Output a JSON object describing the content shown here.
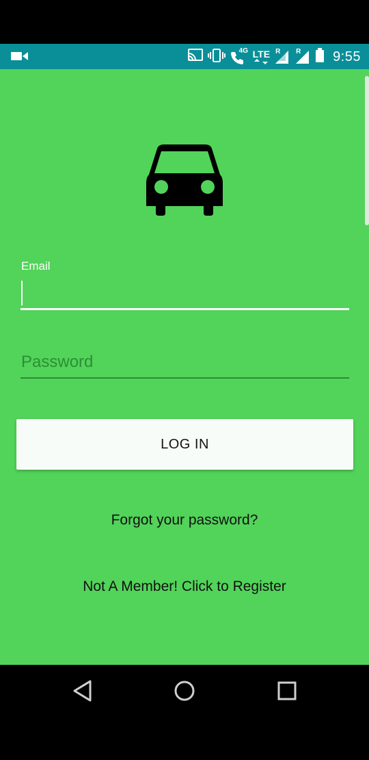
{
  "status_bar": {
    "time": "9:55",
    "network": "LTE",
    "network_4g": "4G",
    "roaming": "R",
    "color": "#0a8f99",
    "icons": [
      "video-camera-icon",
      "cast-icon",
      "vibrate-icon",
      "wifi-calling-icon",
      "lte-icon",
      "signal-icon",
      "signal-icon",
      "battery-icon"
    ]
  },
  "app": {
    "background": "#52d35a",
    "logo_icon": "car-icon",
    "email": {
      "label": "Email",
      "value": ""
    },
    "password": {
      "placeholder": "Password",
      "value": ""
    },
    "login_button": "LOG IN",
    "forgot_password": "Forgot your password?",
    "register": "Not A Member! Click to Register"
  },
  "nav_bar": {
    "items": [
      "back-icon",
      "home-icon",
      "recents-icon"
    ]
  }
}
